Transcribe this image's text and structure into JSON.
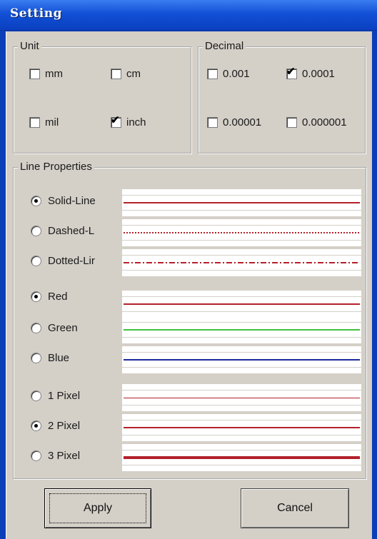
{
  "window": {
    "title": "Setting"
  },
  "unit": {
    "legend": "Unit",
    "options": [
      {
        "label": "mm",
        "checked": false
      },
      {
        "label": "cm",
        "checked": false
      },
      {
        "label": "mil",
        "checked": false
      },
      {
        "label": "inch",
        "checked": true
      }
    ]
  },
  "decimal": {
    "legend": "Decimal",
    "options": [
      {
        "label": "0.001",
        "checked": false
      },
      {
        "label": "0.0001",
        "checked": true
      },
      {
        "label": "0.00001",
        "checked": false
      },
      {
        "label": "0.000001",
        "checked": false
      }
    ]
  },
  "line_properties": {
    "legend": "Line Properties",
    "style": [
      {
        "label": "Solid-Line",
        "selected": true
      },
      {
        "label": "Dashed-L",
        "selected": false
      },
      {
        "label": "Dotted-Lir",
        "selected": false
      }
    ],
    "color": [
      {
        "label": "Red",
        "selected": true,
        "hex": "#c0202c"
      },
      {
        "label": "Green",
        "selected": false,
        "hex": "#40c040"
      },
      {
        "label": "Blue",
        "selected": false,
        "hex": "#1a2a9a"
      }
    ],
    "width": [
      {
        "label": "1 Pixel",
        "selected": false
      },
      {
        "label": "2 Pixel",
        "selected": true
      },
      {
        "label": "3 Pixel",
        "selected": false
      }
    ]
  },
  "buttons": {
    "apply": "Apply",
    "cancel": "Cancel"
  },
  "colors": {
    "title_bar": "#1250d6",
    "dialog_bg": "#d4d0c8",
    "line_red": "#b3202a"
  }
}
